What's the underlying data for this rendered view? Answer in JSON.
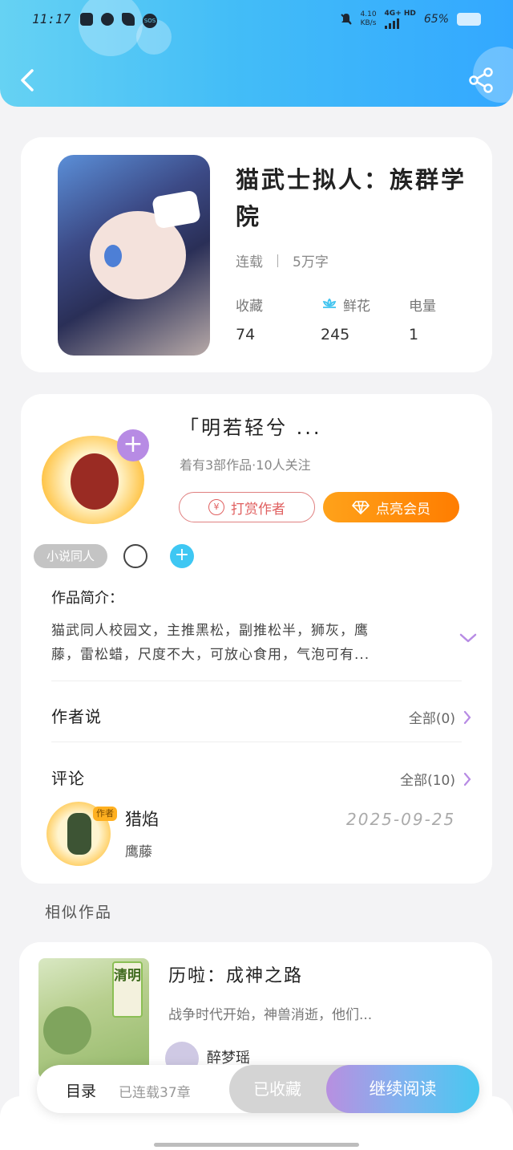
{
  "status_bar": {
    "time": "11:17",
    "sos": "SOS",
    "net_speed": "4.10",
    "net_unit": "KB/s",
    "network": "4G+ HD",
    "battery": "65%"
  },
  "book": {
    "title": "猫武士拟人：族群学院",
    "status": "连载",
    "word_count": "5万字",
    "stats": [
      {
        "label": "收藏",
        "value": "74"
      },
      {
        "label": "鲜花",
        "value": "245"
      },
      {
        "label": "电量",
        "value": "1"
      }
    ]
  },
  "author": {
    "name": "「明若轻兮 ...",
    "summary": "着有3部作品·10人关注",
    "tip_label": "打赏作者",
    "tip_icon_char": "¥",
    "vip_label": "点亮会员",
    "tag": "小说同人"
  },
  "intro": {
    "title": "作品简介：",
    "line1": "猫武同人校园文，主推黑松，副推松半，狮灰，鹰",
    "line2": "藤，雷松蜡，尺度不大，可放心食用，气泡可有..."
  },
  "author_says": {
    "title": "作者说",
    "link": "全部(0)"
  },
  "comments": {
    "title": "评论",
    "link": "全部(10)",
    "item": {
      "badge": "作者",
      "name": "猎焰",
      "date": "2025-09-25",
      "text": "鹰藤"
    }
  },
  "similar": {
    "label": "相似作品",
    "item": {
      "cover_text": "清明",
      "title": "历啦：成神之路",
      "desc": "战争时代开始，神兽消逝，他们...",
      "author": "醉梦瑶"
    }
  },
  "bottom_bar": {
    "toc": "目录",
    "progress": "已连载37章",
    "collected": "已收藏",
    "read": "继续阅读"
  },
  "colors": {
    "header_start": "#66d2f3",
    "header_end": "#33a8ff",
    "vip_orange": "#ff8a00",
    "tip_red": "#e06060",
    "accent_purple": "#b78be4"
  }
}
